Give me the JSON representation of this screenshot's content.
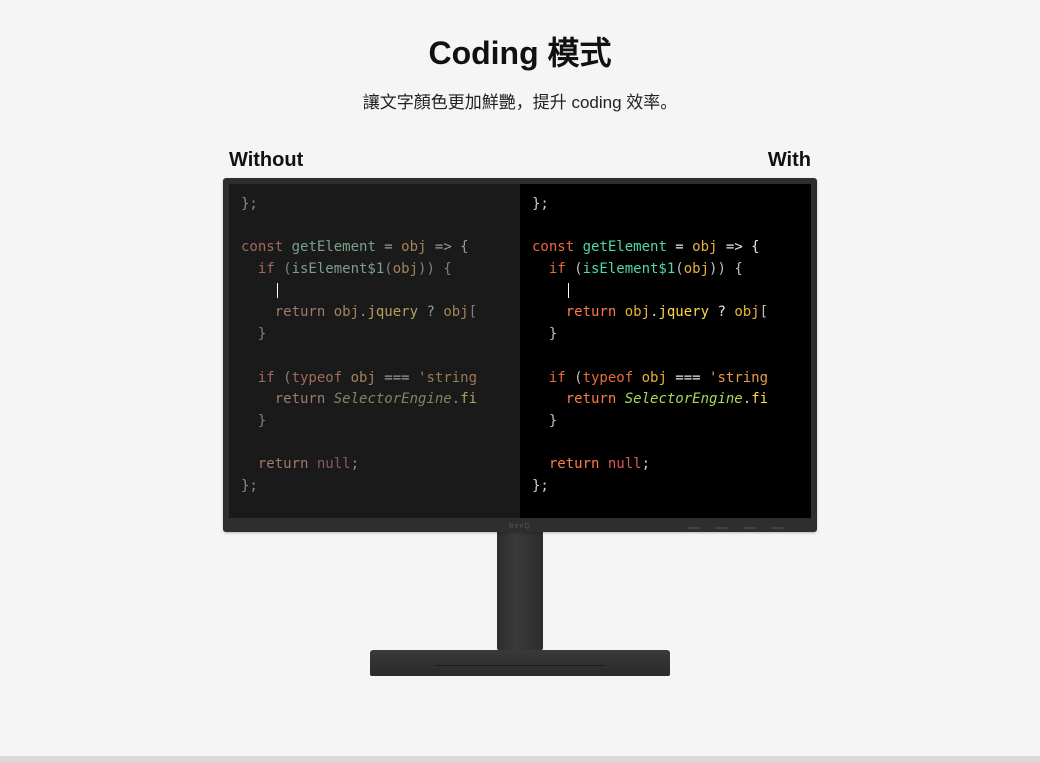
{
  "title": "Coding 模式",
  "subtitle": "讓文字顏色更加鮮艷，提升 coding 效率。",
  "labels": {
    "without": "Without",
    "with": "With"
  },
  "brand": "BenQ",
  "code": {
    "l1a": "};",
    "l2_kw": "const",
    "l2_fn": " getElement",
    "l2_op": " = ",
    "l2_id": "obj",
    "l2_ar": " => {",
    "l3_kw": "if",
    "l3_op1": " (",
    "l3_fn": "isElement$1",
    "l3_op2": "(",
    "l3_id": "obj",
    "l3_op3": ")) {",
    "l4_ret": "return",
    "l4_id": " obj",
    "l4_dot": ".",
    "l4_mth": "jquery",
    "l4_op": " ? ",
    "l4_id2": "obj",
    "l4_br": "[",
    "l5": "}",
    "l6_kw": "if",
    "l6_op1": " (",
    "l6_ty": "typeof",
    "l6_id": " obj",
    "l6_op2": " === ",
    "l6_str": "'string",
    "l7_ret": "return",
    "l7_sp": " ",
    "l7_cls": "SelectorEngine",
    "l7_dot": ".",
    "l7_mth": "fi",
    "l8": "}",
    "l9_ret": "return",
    "l9_sp": " ",
    "l9_nul": "null",
    "l9_semi": ";",
    "l10": "};"
  }
}
